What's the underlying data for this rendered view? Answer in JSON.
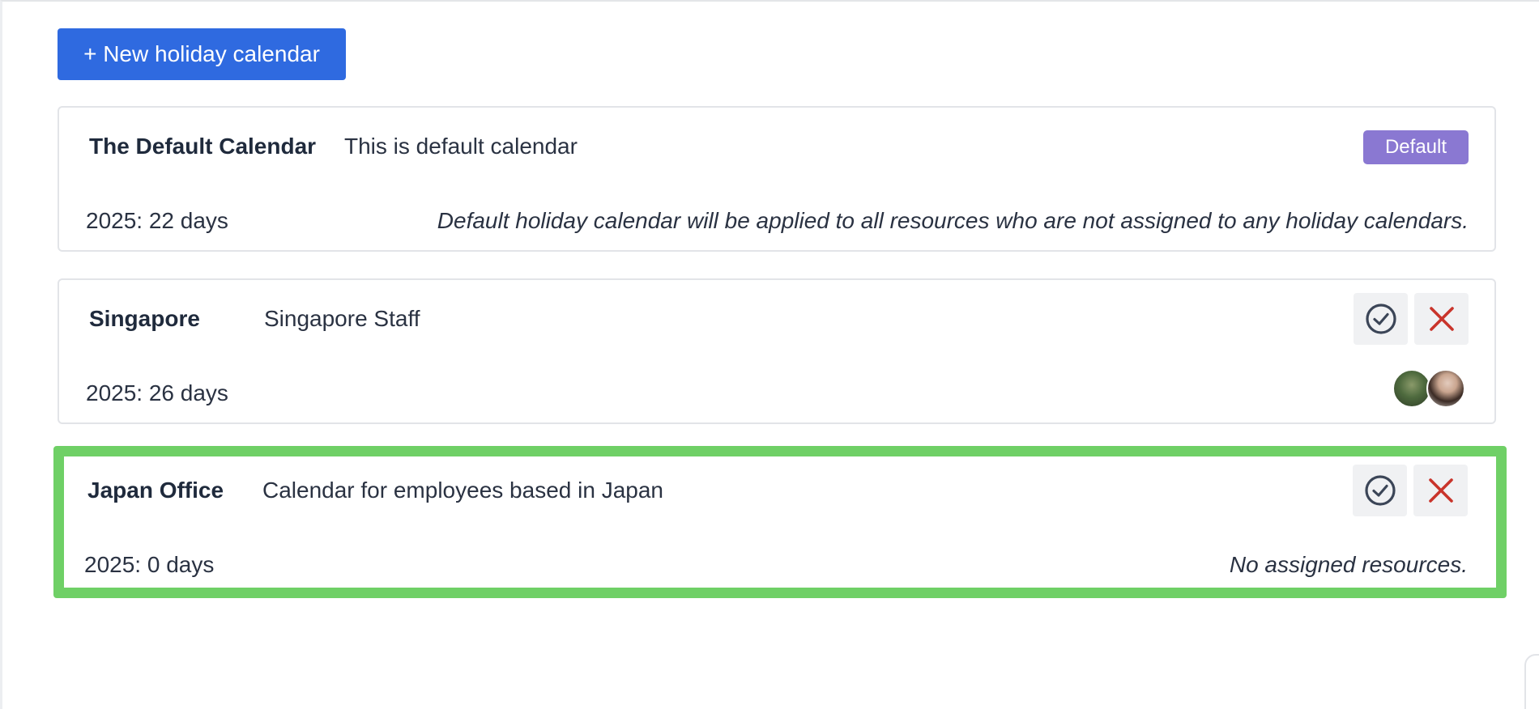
{
  "toolbar": {
    "new_button_label": "+ New holiday calendar"
  },
  "calendars": [
    {
      "name": "The Default Calendar",
      "description": "This is default calendar",
      "badge": "Default",
      "days": "2025: 22 days",
      "note": "Default holiday calendar will be applied to all resources who are not assigned to any holiday calendars."
    },
    {
      "name": "Singapore",
      "description": "Singapore Staff",
      "days": "2025: 26 days",
      "assigned_resources": 2
    },
    {
      "name": "Japan Office",
      "description": "Calendar for employees based in Japan",
      "days": "2025: 0 days",
      "note": "No assigned resources.",
      "highlighted": true
    }
  ],
  "icons": {
    "confirm": "check-circle-icon",
    "delete": "close-icon"
  },
  "colors": {
    "primary_button": "#2f6ae0",
    "default_badge": "#8a78d2",
    "delete_icon": "#c9342b",
    "highlight_border": "#6fd066"
  }
}
